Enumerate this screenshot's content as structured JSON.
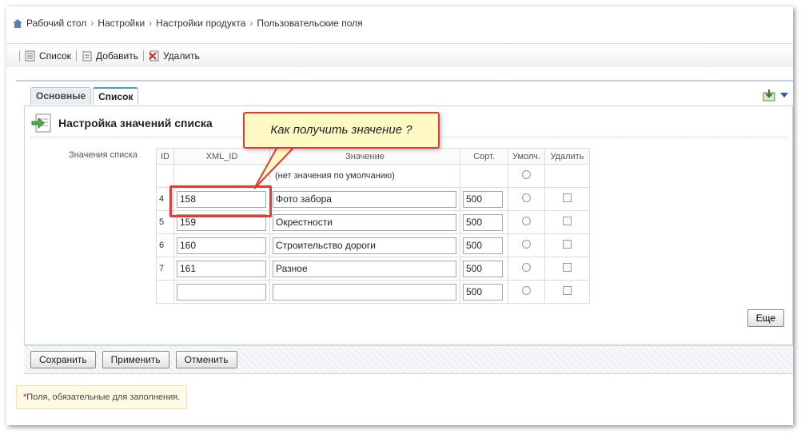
{
  "breadcrumb": [
    "Рабочий стол",
    "Настройки",
    "Настройки продукта",
    "Пользовательские поля"
  ],
  "toolbar": {
    "list_label": "Список",
    "add_label": "Добавить",
    "delete_label": "Удалить"
  },
  "tabs": [
    {
      "label": "Основные",
      "active": false
    },
    {
      "label": "Список",
      "active": true
    }
  ],
  "panel": {
    "title": "Настройка значений списка",
    "field_label": "Значения списка",
    "columns": [
      "ID",
      "XML_ID",
      "Значение",
      "Сорт.",
      "Умолч.",
      "Удалить"
    ],
    "default_row_text": "(нет значения по умолчанию)",
    "rows": [
      {
        "id": "4",
        "xml_id": "158",
        "value": "Фото забора",
        "sort": "500"
      },
      {
        "id": "5",
        "xml_id": "159",
        "value": "Окрестности",
        "sort": "500"
      },
      {
        "id": "6",
        "xml_id": "160",
        "value": "Строительство дороги",
        "sort": "500"
      },
      {
        "id": "7",
        "xml_id": "161",
        "value": "Разное",
        "sort": "500"
      },
      {
        "id": "",
        "xml_id": "",
        "value": "",
        "sort": "500"
      }
    ],
    "more_label": "Еще"
  },
  "buttons": {
    "save": "Сохранить",
    "apply": "Применить",
    "cancel": "Отменить"
  },
  "required_note": "Поля, обязательные для заполнения.",
  "required_star": "*",
  "callout_text": "Как получить значение ?",
  "colors": {
    "accent_red": "#e53935",
    "callout_bg": "#fff9c4",
    "tab_accent": "#46a0d6"
  }
}
